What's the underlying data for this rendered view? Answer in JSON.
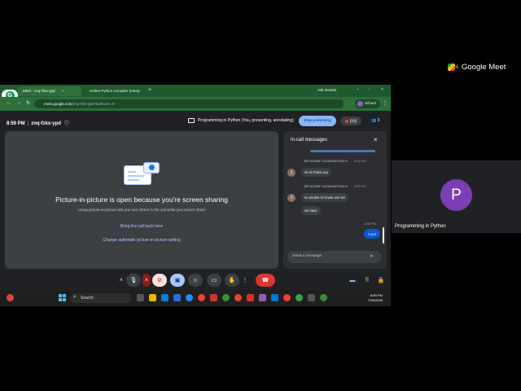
{
  "meet_brand": {
    "label": "Google Meet"
  },
  "side_tile": {
    "avatar_letter": "P",
    "name": "Programming in Python"
  },
  "browser": {
    "tabs": [
      {
        "label": "Meet - znq-fzkx-ypd",
        "active": true
      },
      {
        "label": "Online Python Compiler (Interp",
        "active": false
      }
    ],
    "ask_gemini": "Ask Gemini",
    "url_host": "meet.google.com",
    "url_path": "/znq-fzkx-ypd?authuser=0",
    "profile_label": "School"
  },
  "meet_bar": {
    "time": "8:59 PM",
    "meeting_code": "znq-fzkx-ypd",
    "presenting_text": "Programming in Python (You, presenting, annotating)",
    "stop_label": "Stop presenting",
    "participant_count": "3"
  },
  "pip": {
    "title": "Picture-in-picture is open because you're screen sharing",
    "subtitle": "Using picture-in-picture lets you see others in the call while you screen share",
    "bring_back": "Bring the call back here",
    "change_setting": "Change automatic picture-in-picture setting"
  },
  "chat": {
    "title": "In-call messages",
    "messages": [
      {
        "sender": "25F110005P JAGANNATHAN N",
        "time": "8:54 PM",
        "avatar": "J",
        "lines": [
          "ok sir thank you"
        ]
      },
      {
        "sender": "25F110005P JAGANNATHAN N",
        "time": "8:59 PM",
        "avatar": "J",
        "lines": [
          "no doubts sir thank asir sir!",
          "we have"
        ]
      }
    ],
    "my_time": "8:59 PM",
    "my_message": "Cool",
    "input_placeholder": "Send a message"
  },
  "taskbar": {
    "search_placeholder": "Search",
    "clock_time": "8:59 PM",
    "clock_date": "7/28/2026"
  },
  "colors": {
    "accent": "#8ab4f8",
    "hangup": "#dc362e",
    "chrome_green": "#2d6e3a",
    "avatar_purple": "#7b3fb3"
  }
}
